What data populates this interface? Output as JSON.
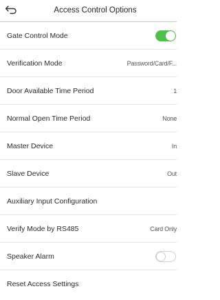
{
  "header": {
    "title": "Access Control Options",
    "back_icon": "back-arrow-icon"
  },
  "colors": {
    "toggle_on": "#4cc14c",
    "toggle_off_border": "#cfcfcf",
    "divider": "#e6e6e6"
  },
  "rows": [
    {
      "label": "Gate Control Mode",
      "value": "",
      "toggle": "on"
    },
    {
      "label": "Verification Mode",
      "value": "Password/Card/F..."
    },
    {
      "label": "Door Available Time Period",
      "value": "1"
    },
    {
      "label": "Normal Open Time Period",
      "value": "None"
    },
    {
      "label": "Master Device",
      "value": "In"
    },
    {
      "label": "Slave Device",
      "value": "Out"
    },
    {
      "label": "Auxiliary Input Configuration",
      "value": ""
    },
    {
      "label": "Verify Mode by RS485",
      "value": "Card Only"
    },
    {
      "label": "Speaker Alarm",
      "value": "",
      "toggle": "off"
    },
    {
      "label": "Reset Access Settings",
      "value": ""
    }
  ]
}
